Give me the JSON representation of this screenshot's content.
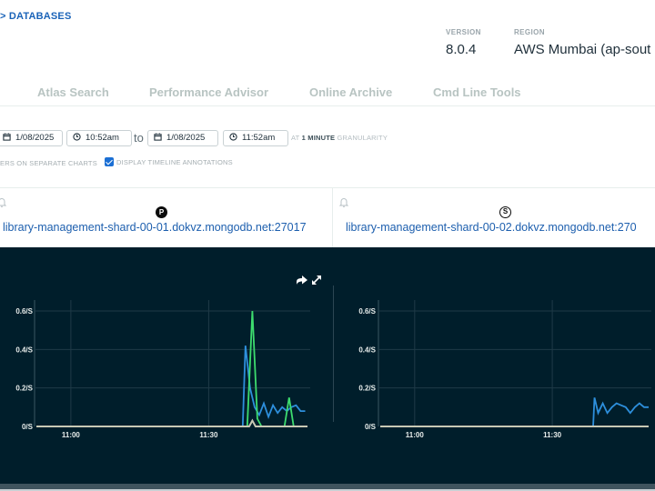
{
  "breadcrumb": {
    "text": "> DATABASES"
  },
  "meta": {
    "version_label": "VERSION",
    "version_value": "8.0.4",
    "region_label": "REGION",
    "region_value": "AWS Mumbai (ap-sout"
  },
  "tabs": [
    {
      "label": "Atlas Search"
    },
    {
      "label": "Performance Advisor"
    },
    {
      "label": "Online Archive"
    },
    {
      "label": "Cmd Line Tools"
    }
  ],
  "controls": {
    "start_date": "1/08/2025",
    "start_time": "10:52am",
    "to_label": "to",
    "end_date": "1/08/2025",
    "end_time": "11:52am",
    "granularity_prefix": "AT",
    "granularity_value": "1 MINUTE",
    "granularity_suffix": "GRANULARITY"
  },
  "options": {
    "separate_charts_label": "ERS ON SEPARATE CHARTS",
    "annotations_label": "DISPLAY TIMELINE ANNOTATIONS",
    "annotations_checked": true
  },
  "hosts": [
    {
      "role": "P",
      "name": "library-management-shard-00-01.dokvz.mongodb.net:27017"
    },
    {
      "role": "S",
      "name": "library-management-shard-00-02.dokvz.mongodb.net:270"
    }
  ],
  "colors": {
    "series_blue": "#2d8fdc",
    "series_green": "#3ddc6e",
    "series_gray": "#c8c8b4",
    "chart_bg": "#001e2b",
    "link": "#1d5fae"
  },
  "chart_data": [
    {
      "type": "line",
      "title": "",
      "xlabel": "",
      "ylabel": "",
      "x_unit": "minutes after 11:00",
      "xlim": [
        -7.5,
        51.5
      ],
      "ylim": [
        0,
        0.6
      ],
      "yticks": [
        0,
        0.2,
        0.4,
        0.6
      ],
      "ytick_labels": [
        "0/S",
        "0.2/S",
        "0.4/S",
        "0.6/S"
      ],
      "xticks": [
        0,
        30
      ],
      "xtick_labels": [
        "11:00",
        "11:30"
      ],
      "grid": true,
      "series": [
        {
          "name": "blue",
          "color": "#2d8fdc",
          "x": [
            -7.5,
            37.4,
            38,
            39,
            40,
            41,
            42,
            43,
            44,
            45,
            46,
            47,
            48,
            49,
            50,
            51
          ],
          "y": [
            0,
            0,
            0.42,
            0.2,
            0.1,
            0.06,
            0.12,
            0.05,
            0.11,
            0.07,
            0.1,
            0.08,
            0.1,
            0.11,
            0.08,
            0.08
          ]
        },
        {
          "name": "green",
          "color": "#3ddc6e",
          "x": [
            -7.5,
            38.4,
            39.5,
            40.6,
            41.5,
            46.5,
            47.5,
            48.5,
            51.5
          ],
          "y": [
            0,
            0,
            0.6,
            0.04,
            0,
            0,
            0.15,
            0,
            0
          ]
        },
        {
          "name": "gray",
          "color": "#c8c8b4",
          "x": [
            -7.5,
            38.8,
            39.5,
            40.2,
            51.5
          ],
          "y": [
            0,
            0,
            0.03,
            0,
            0
          ]
        }
      ]
    },
    {
      "type": "line",
      "title": "",
      "xlabel": "",
      "ylabel": "",
      "x_unit": "minutes after 11:00",
      "xlim": [
        -7.5,
        51
      ],
      "ylim": [
        0,
        0.6
      ],
      "yticks": [
        0,
        0.2,
        0.4,
        0.6
      ],
      "ytick_labels": [
        "0/S",
        "0.2/S",
        "0.4/S",
        "0.6/S"
      ],
      "xticks": [
        0,
        30
      ],
      "xtick_labels": [
        "11:00",
        "11:30"
      ],
      "grid": true,
      "series": [
        {
          "name": "blue",
          "color": "#2d8fdc",
          "x": [
            -7.5,
            38.9,
            39.2,
            40,
            41,
            42,
            43,
            44,
            45,
            46,
            47,
            48,
            49,
            50,
            51
          ],
          "y": [
            0,
            0,
            0.15,
            0.07,
            0.12,
            0.07,
            0.1,
            0.12,
            0.11,
            0.1,
            0.07,
            0.1,
            0.12,
            0.1,
            0.1
          ]
        },
        {
          "name": "gray",
          "color": "#c8c8b4",
          "x": [
            -7.5,
            51
          ],
          "y": [
            0,
            0
          ]
        }
      ]
    }
  ]
}
